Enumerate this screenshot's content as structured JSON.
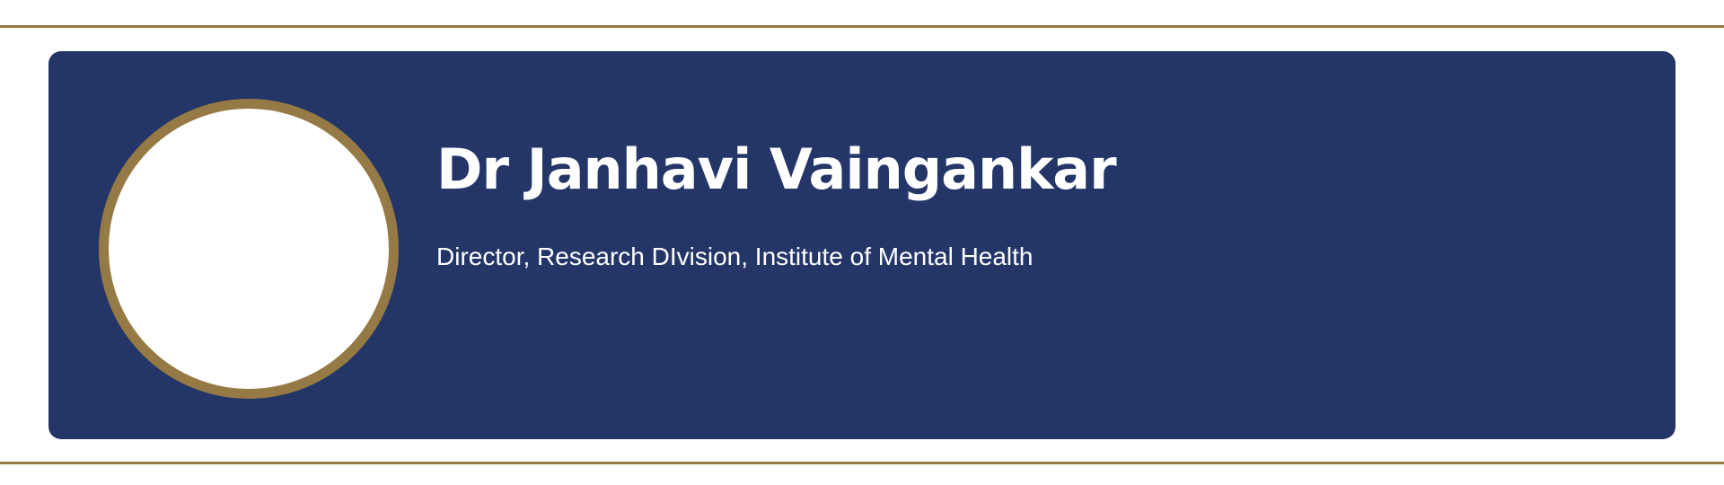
{
  "colors": {
    "accent_gold": "#957a45",
    "card_navy": "#243668",
    "background": "#ffffff",
    "text": "#ffffff"
  },
  "profile": {
    "name": "Dr Janhavi Vaingankar",
    "title": "Director, Research DIvision, Institute of Mental Health"
  }
}
